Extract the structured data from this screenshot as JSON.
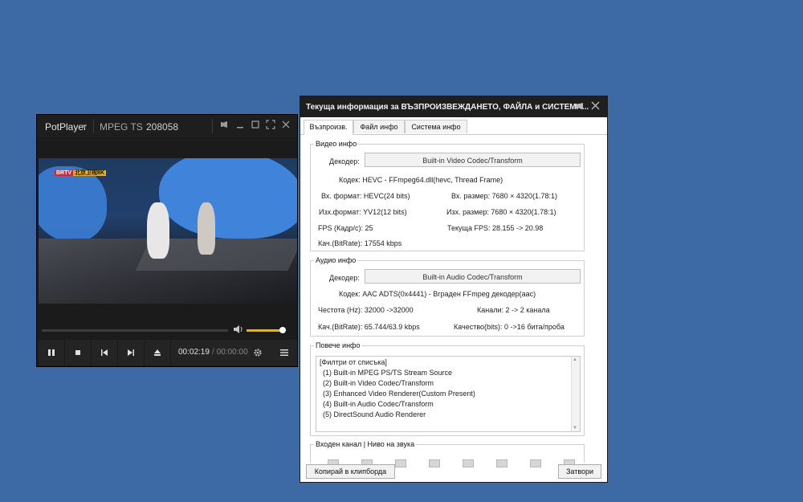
{
  "player": {
    "app_name": "PotPlayer",
    "chevron": "▾",
    "format": "MPEG TS",
    "bitrate": "208058",
    "video_logo_a": "BRTV",
    "video_logo_b": "北京卫视8K",
    "time_current": "00:02:19",
    "time_separator": "/",
    "time_total": "00:00:00"
  },
  "dialog": {
    "title": "Текуща информация за ВЪЗПРОИЗВЕЖДАНЕТО, ФАЙЛА и СИСТЕМА...",
    "tabs": [
      "Възпроизв.",
      "Файл инфо",
      "Система инфо"
    ],
    "video": {
      "legend": "Видео инфо",
      "decoder_label": "Декодер:",
      "decoder_value": "Built-in Video Codec/Transform",
      "codec_line": "Кодек: HEVC - FFmpeg64.dll(hevc, Thread Frame)",
      "in_format": "Вх. формат: HEVC(24 bits)",
      "in_size": "Вх. размер: 7680 × 4320(1.78:1)",
      "out_format": "Изх.формат: YV12(12 bits)",
      "out_size": "Изх. размер: 7680 × 4320(1.78:1)",
      "fps": "FPS (Кадр/с): 25",
      "current_fps": "Текуща FPS: 28.155 -> 20.98",
      "bitrate": "Кач.(BitRate): 17554 kbps"
    },
    "audio": {
      "legend": "Аудио инфо",
      "decoder_label": "Декодер:",
      "decoder_value": "Built-in Audio Codec/Transform",
      "codec_line": "Кодек: AAC ADTS(0x4441) - Вграден FFmpeg декодер(aac)",
      "frequency": "Честота (Hz): 32000 ->32000",
      "channels": "Канали: 2 -> 2 канала",
      "bitrate": "Кач.(BitRate): 65.744/63.9 kbps",
      "quality": "Качество(bits): 0 ->16 бита/проба"
    },
    "more": {
      "legend": "Повече инфо",
      "items": [
        "[Филтри от списъка]",
        "(1) Built-in MPEG PS/TS Stream Source",
        "(2) Built-in Video Codec/Transform",
        "(3) Enhanced Video Renderer(Custom Present)",
        "(4) Built-in Audio Codec/Transform",
        "(5) DirectSound Audio Renderer"
      ]
    },
    "levels": {
      "legend": "Входен канал | Ниво на звука"
    },
    "copy_button": "Копирай в клипборда",
    "close_button": "Затвори"
  }
}
